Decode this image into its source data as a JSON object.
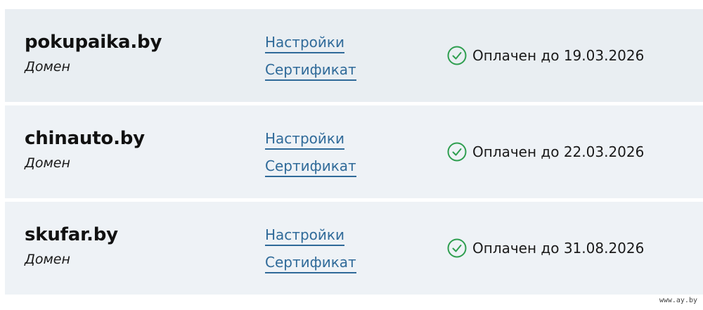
{
  "domains": [
    {
      "name": "pokupaika.by",
      "type": "Домен",
      "settings_label": "Настройки",
      "certificate_label": "Сертификат",
      "status": "Оплачен до 19.03.2026"
    },
    {
      "name": "chinauto.by",
      "type": "Домен",
      "settings_label": "Настройки",
      "certificate_label": "Сертификат",
      "status": "Оплачен до 22.03.2026"
    },
    {
      "name": "skufar.by",
      "type": "Домен",
      "settings_label": "Настройки",
      "certificate_label": "Сертификат",
      "status": "Оплачен до 31.08.2026"
    }
  ],
  "status_icon": "check-circle-icon",
  "colors": {
    "link": "#2f6a99",
    "status_ok": "#2e9e4f",
    "row_background": "#eef2f6"
  },
  "watermark": "www.ay.by"
}
